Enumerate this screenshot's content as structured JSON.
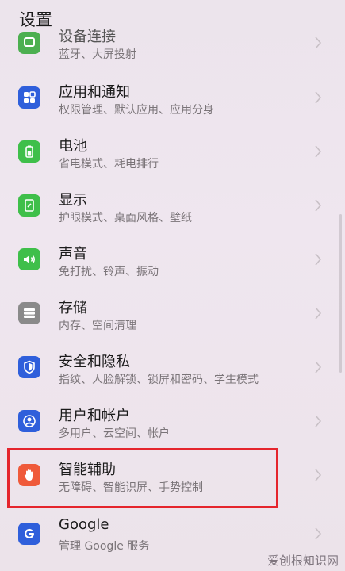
{
  "header": {
    "title": "设置"
  },
  "items": [
    {
      "title": "设备连接",
      "subtitle": "蓝牙、大屏投射",
      "color": "#4caf50",
      "icon": "device-connection-icon"
    },
    {
      "title": "应用和通知",
      "subtitle": "权限管理、默认应用、应用分身",
      "color": "#2f5fdb",
      "icon": "apps-grid-icon"
    },
    {
      "title": "电池",
      "subtitle": "省电模式、耗电排行",
      "color": "#3fbf4a",
      "icon": "battery-icon"
    },
    {
      "title": "显示",
      "subtitle": "护眼模式、桌面风格、壁纸",
      "color": "#3fbf4a",
      "icon": "display-icon"
    },
    {
      "title": "声音",
      "subtitle": "免打扰、铃声、振动",
      "color": "#3fbf4a",
      "icon": "speaker-icon"
    },
    {
      "title": "存储",
      "subtitle": "内存、空间清理",
      "color": "#8a8a8a",
      "icon": "storage-icon"
    },
    {
      "title": "安全和隐私",
      "subtitle": "指纹、人脸解锁、锁屏和密码、学生模式",
      "color": "#2f5fdb",
      "icon": "shield-icon"
    },
    {
      "title": "用户和帐户",
      "subtitle": "多用户、云空间、帐户",
      "color": "#2f5fdb",
      "icon": "user-icon"
    },
    {
      "title": "智能辅助",
      "subtitle": "无障碍、智能识屏、手势控制",
      "color": "#ef5a3a",
      "icon": "hand-icon"
    },
    {
      "title": "Google",
      "subtitle": "管理 Google 服务",
      "color": "#2f5fdb",
      "icon": "google-icon"
    }
  ],
  "watermark": "爱创根知识网"
}
